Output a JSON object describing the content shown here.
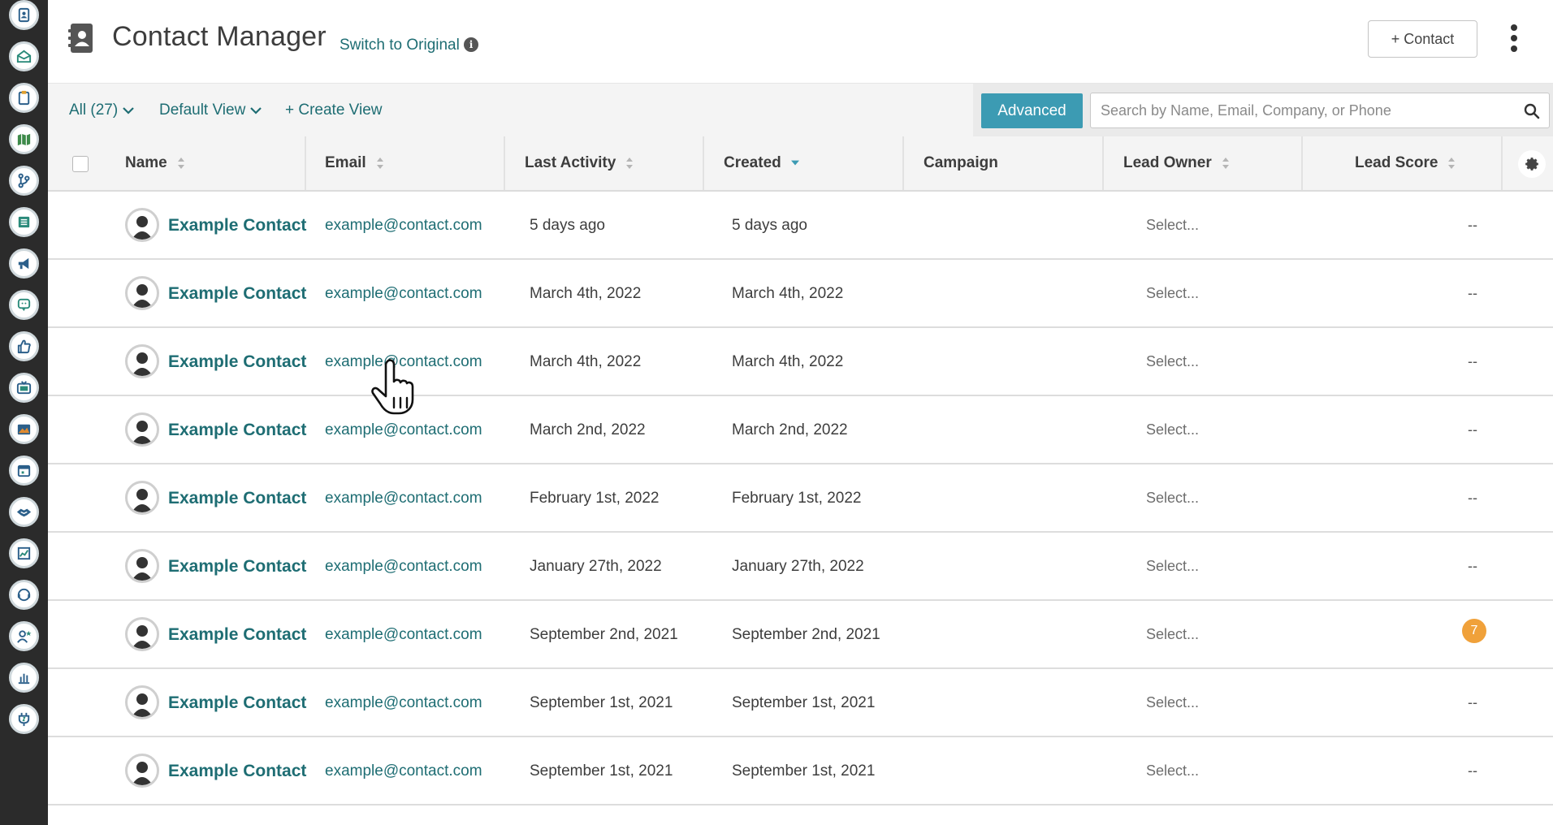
{
  "app": {
    "title": "Contact Manager",
    "switch_link": "Switch to Original",
    "add_contact_label": "+ Contact"
  },
  "sidebar": {
    "items": [
      {
        "name": "contacts-icon"
      },
      {
        "name": "inbox-icon"
      },
      {
        "name": "clipboard-icon"
      },
      {
        "name": "map-icon"
      },
      {
        "name": "branch-icon"
      },
      {
        "name": "list-icon"
      },
      {
        "name": "megaphone-icon"
      },
      {
        "name": "chat-icon"
      },
      {
        "name": "thumbs-up-icon"
      },
      {
        "name": "tv-icon"
      },
      {
        "name": "image-icon"
      },
      {
        "name": "calendar-icon"
      },
      {
        "name": "handshake-icon"
      },
      {
        "name": "analytics-icon"
      },
      {
        "name": "support-icon"
      },
      {
        "name": "user-star-icon"
      },
      {
        "name": "bar-chart-icon"
      },
      {
        "name": "plug-icon"
      }
    ]
  },
  "toolbar": {
    "filter_label": "All (27)",
    "view_label": "Default View",
    "create_view_label": "+ Create View",
    "advanced_label": "Advanced",
    "search_placeholder": "Search by Name, Email, Company, or Phone"
  },
  "table": {
    "columns": [
      "Name",
      "Email",
      "Last Activity",
      "Created",
      "Campaign",
      "Lead Owner",
      "Lead Score"
    ],
    "rows": [
      {
        "name": "Example Contact",
        "email": "example@contact.com",
        "last_activity": "5 days ago",
        "created": "5 days ago",
        "campaign": "",
        "owner": "Select...",
        "score": "--"
      },
      {
        "name": "Example Contact",
        "email": "example@contact.com",
        "last_activity": "March 4th, 2022",
        "created": "March 4th, 2022",
        "campaign": "",
        "owner": "Select...",
        "score": "--"
      },
      {
        "name": "Example Contact",
        "email": "example@contact.com",
        "last_activity": "March 4th, 2022",
        "created": "March 4th, 2022",
        "campaign": "",
        "owner": "Select...",
        "score": "--"
      },
      {
        "name": "Example Contact",
        "email": "example@contact.com",
        "last_activity": "March 2nd, 2022",
        "created": "March 2nd, 2022",
        "campaign": "",
        "owner": "Select...",
        "score": "--"
      },
      {
        "name": "Example Contact",
        "email": "example@contact.com",
        "last_activity": "February 1st, 2022",
        "created": "February 1st, 2022",
        "campaign": "",
        "owner": "Select...",
        "score": "--"
      },
      {
        "name": "Example Contact",
        "email": "example@contact.com",
        "last_activity": "January 27th, 2022",
        "created": "January 27th, 2022",
        "campaign": "",
        "owner": "Select...",
        "score": "--"
      },
      {
        "name": "Example Contact",
        "email": "example@contact.com",
        "last_activity": "September 2nd, 2021",
        "created": "September 2nd, 2021",
        "campaign": "",
        "owner": "Select...",
        "score": "7"
      },
      {
        "name": "Example Contact",
        "email": "example@contact.com",
        "last_activity": "September 1st, 2021",
        "created": "September 1st, 2021",
        "campaign": "",
        "owner": "Select...",
        "score": "--"
      },
      {
        "name": "Example Contact",
        "email": "example@contact.com",
        "last_activity": "September 1st, 2021",
        "created": "September 1st, 2021",
        "campaign": "",
        "owner": "Select...",
        "score": "--"
      }
    ]
  },
  "colors": {
    "accent": "#3c9bb3",
    "link": "#1e6d73",
    "badge": "#f0a13a",
    "sidebar": "#2b2b2b"
  }
}
